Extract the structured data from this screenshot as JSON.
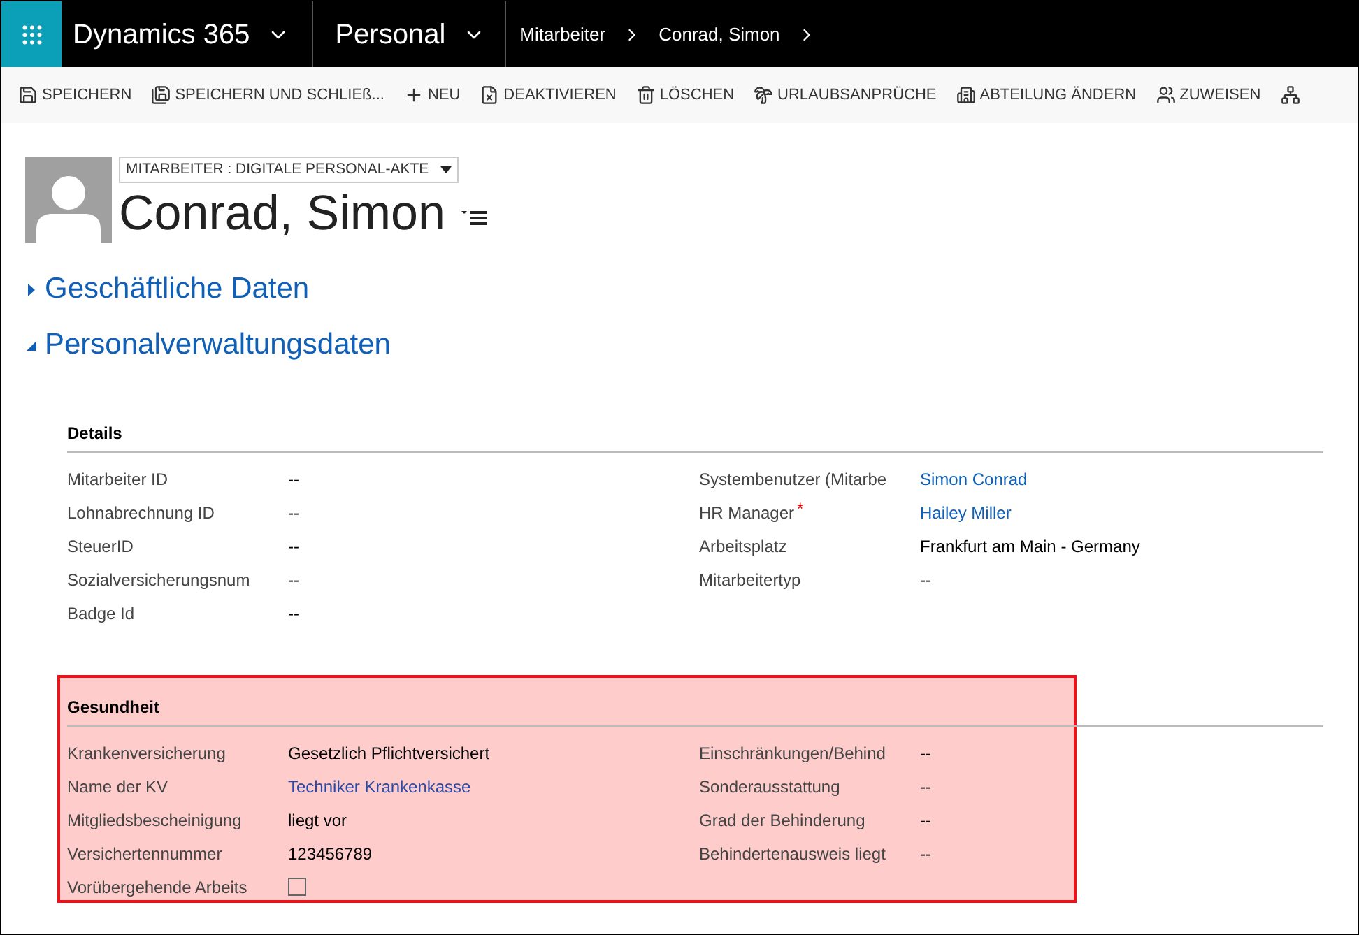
{
  "top_bar": {
    "app": "Dynamics 365",
    "area": "Personal",
    "breadcrumbs": [
      "Mitarbeiter",
      "Conrad, Simon"
    ]
  },
  "commands": [
    {
      "label": "SPEICHERN"
    },
    {
      "label": "SPEICHERN UND SCHLIEß..."
    },
    {
      "label": "NEU"
    },
    {
      "label": "DEAKTIVIEREN"
    },
    {
      "label": "LÖSCHEN"
    },
    {
      "label": "URLAUBSANPRÜCHE"
    },
    {
      "label": "ABTEILUNG ÄNDERN"
    },
    {
      "label": "ZUWEISEN"
    }
  ],
  "record": {
    "form_selector": "MITARBEITER : DIGITALE PERSONAL-AKTE",
    "name": "Conrad, Simon"
  },
  "tabs": [
    {
      "title": "Geschäftliche Daten",
      "expanded": false
    },
    {
      "title": "Personalverwaltungsdaten",
      "expanded": true
    }
  ],
  "sections": [
    {
      "title": "Details",
      "highlighted": false,
      "left": [
        {
          "label": "Mitarbeiter ID",
          "kind": "text",
          "value": "--"
        },
        {
          "label": "Lohnabrechnung ID",
          "kind": "text",
          "value": "--"
        },
        {
          "label": "SteuerID",
          "kind": "text",
          "value": "--"
        },
        {
          "label": "Sozialversicherungsnum",
          "kind": "text",
          "value": "--"
        },
        {
          "label": "Badge Id",
          "kind": "text",
          "value": "--"
        }
      ],
      "right": [
        {
          "label": "Systembenutzer (Mitarbe",
          "kind": "link",
          "value": "Simon Conrad"
        },
        {
          "label": "HR Manager",
          "required_mark": "*",
          "kind": "link",
          "value": "Hailey Miller"
        },
        {
          "label": "Arbeitsplatz",
          "kind": "text",
          "value": "Frankfurt am Main - Germany"
        },
        {
          "label": "Mitarbeitertyp",
          "kind": "text",
          "value": "--"
        }
      ]
    },
    {
      "title": "Gesundheit",
      "highlighted": true,
      "left": [
        {
          "label": "Krankenversicherung",
          "kind": "text",
          "value": "Gesetzlich Pflichtversichert"
        },
        {
          "label": "Name der KV",
          "kind": "link",
          "value": "Techniker Krankenkasse"
        },
        {
          "label": "Mitgliedsbescheinigung",
          "kind": "text",
          "value": "liegt vor"
        },
        {
          "label": "Versichertennummer",
          "kind": "text",
          "value": "123456789"
        },
        {
          "label": "Vorübergehende Arbeits",
          "kind": "checkbox",
          "checked": false
        }
      ],
      "right": [
        {
          "label": "Einschränkungen/Behind",
          "kind": "text",
          "value": "--"
        },
        {
          "label": "Sonderausstattung",
          "kind": "text",
          "value": "--"
        },
        {
          "label": "Grad der Behinderung",
          "kind": "text",
          "value": "--"
        },
        {
          "label": "Behindertenausweis liegt",
          "kind": "text",
          "value": "--"
        }
      ]
    }
  ]
}
